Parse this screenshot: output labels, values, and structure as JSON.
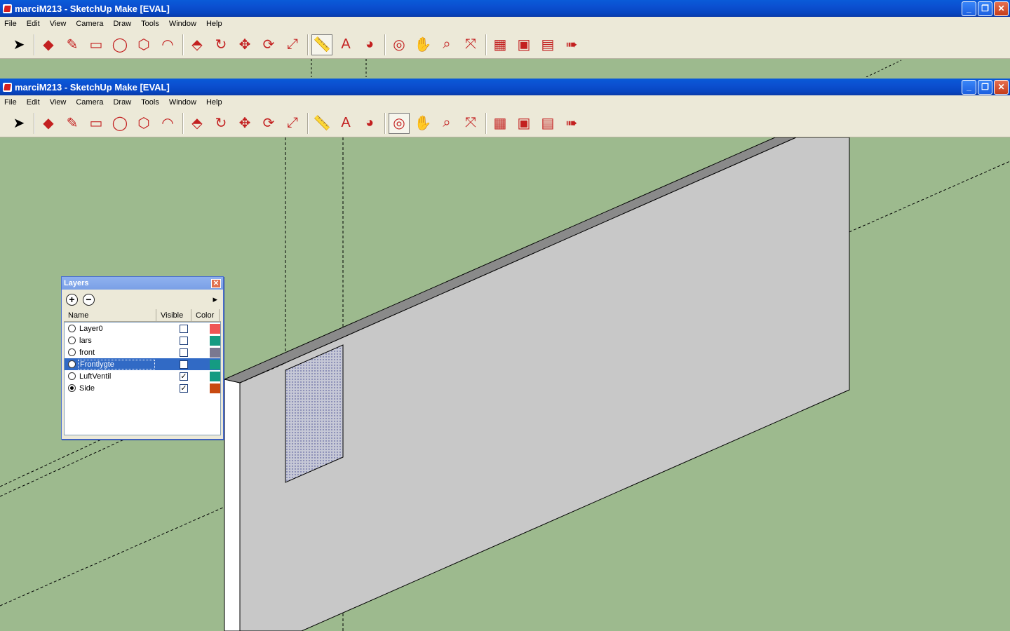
{
  "windows": {
    "back": {
      "title": "marciM213 - SketchUp Make [EVAL]"
    },
    "front": {
      "title": "marciM213 - SketchUp Make [EVAL]"
    }
  },
  "menu": [
    "File",
    "Edit",
    "View",
    "Camera",
    "Draw",
    "Tools",
    "Window",
    "Help"
  ],
  "window_buttons": {
    "minimize": "_",
    "restore": "❐",
    "close": "✕"
  },
  "toolbar": [
    {
      "name": "select-tool",
      "icon": "arrow-icon"
    },
    {
      "name": "eraser-tool",
      "icon": "eraser-icon"
    },
    {
      "name": "line-tool",
      "icon": "pencil-icon"
    },
    {
      "name": "rectangle-tool",
      "icon": "rectangle-icon"
    },
    {
      "name": "circle-tool",
      "icon": "circle-icon"
    },
    {
      "name": "polygon-tool",
      "icon": "polygon-icon"
    },
    {
      "name": "arc-tool",
      "icon": "arc-icon"
    },
    {
      "name": "push-pull-tool",
      "icon": "push-pull-icon"
    },
    {
      "name": "follow-me-tool",
      "icon": "follow-me-icon"
    },
    {
      "name": "move-tool",
      "icon": "move-icon"
    },
    {
      "name": "rotate-tool",
      "icon": "rotate-icon"
    },
    {
      "name": "scale-tool",
      "icon": "scale-icon"
    },
    {
      "name": "tape-measure-tool",
      "icon": "tape-measure-icon"
    },
    {
      "name": "text-tool",
      "icon": "text-icon"
    },
    {
      "name": "paint-bucket-tool",
      "icon": "paint-bucket-icon"
    },
    {
      "name": "orbit-tool",
      "icon": "orbit-icon"
    },
    {
      "name": "pan-tool",
      "icon": "hand-icon"
    },
    {
      "name": "zoom-tool",
      "icon": "magnifier-icon"
    },
    {
      "name": "zoom-extents-tool",
      "icon": "zoom-extents-icon"
    },
    {
      "name": "previous-view-tool",
      "icon": "map-icon"
    },
    {
      "name": "warehouse-tool",
      "icon": "warehouse-icon"
    },
    {
      "name": "share-model-tool",
      "icon": "share-model-icon"
    },
    {
      "name": "send-to-layout-tool",
      "icon": "send-icon"
    }
  ],
  "layers_dialog": {
    "title": "Layers",
    "columns": {
      "name": "Name",
      "visible": "Visible",
      "color": "Color"
    },
    "layers": [
      {
        "name": "Layer0",
        "active": false,
        "visible": false,
        "color": "#ef5555",
        "selected": false
      },
      {
        "name": "lars",
        "active": false,
        "visible": false,
        "color": "#159b82",
        "selected": false
      },
      {
        "name": "front",
        "active": false,
        "visible": false,
        "color": "#7a7890",
        "selected": false
      },
      {
        "name": "Frontlygte",
        "active": false,
        "visible": false,
        "color": "#159b82",
        "selected": true
      },
      {
        "name": "LuftVentil",
        "active": false,
        "visible": true,
        "color": "#159b82",
        "selected": false
      },
      {
        "name": "Side",
        "active": true,
        "visible": true,
        "color": "#c84a10",
        "selected": false
      }
    ]
  },
  "colors": {
    "canvas_bg": "#9dba8e",
    "face": "#c8c8c8",
    "top_edge": "#8a8a8a",
    "selected_face": "#b8bccf"
  }
}
